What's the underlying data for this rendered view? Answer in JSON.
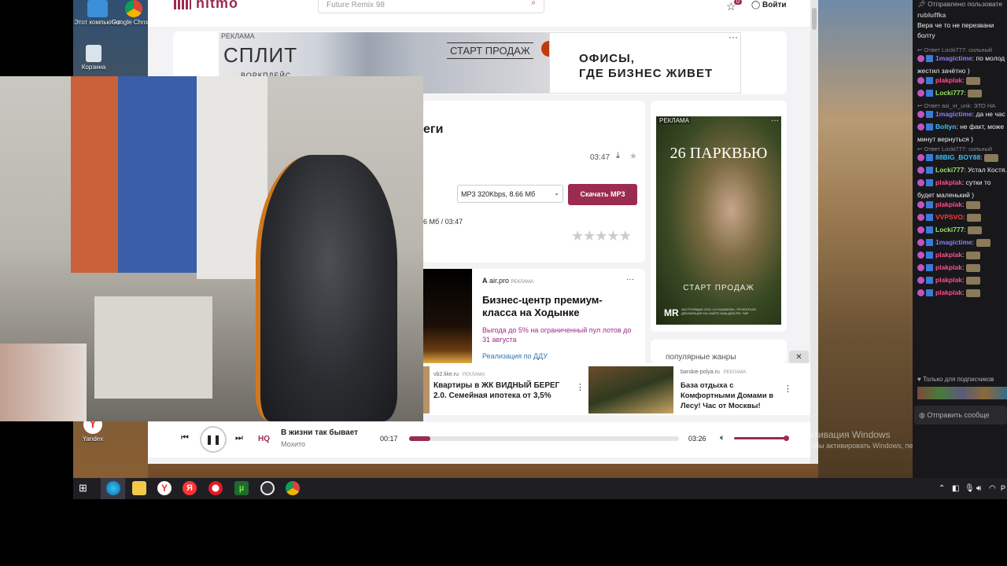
{
  "desktop": {
    "icons": [
      {
        "label": "Этот компьютер"
      },
      {
        "label": "Google Chrome"
      },
      {
        "label": "Корзина"
      },
      {
        "label": "Yandex"
      }
    ]
  },
  "site": {
    "logo": "hitmo",
    "search_value": "Future Remix 98",
    "star_count": "0",
    "login_label": "Войти"
  },
  "ad_top": {
    "tag": "РЕКЛАМА",
    "brand": "СПЛИТ",
    "brand_sub": "ВОРКПЛЕЙС",
    "start_label": "СТАРТ ПРОДАЖ",
    "headline_1": "ОФИСЫ,",
    "headline_2": "ГДЕ БИЗНЕС ЖИВЕТ",
    "more": "···"
  },
  "track_card": {
    "title_fragment": "еги",
    "duration": "03:47",
    "format_option": "MP3 320Kbps, 8.66 Мб",
    "download_label": "Скачать MP3",
    "size_info": "6 Мб / 03:47",
    "rating_stars": 5
  },
  "ad_bc": {
    "source": "air.pro",
    "tag": "РЕКЛАМА",
    "title": "Бизнес-центр премиум-класса на Ходынке",
    "offer": "Выгода до 5% на ограниченный пул лотов до 31 августа",
    "link": "Реализация по ДДУ",
    "more": "···"
  },
  "ad_side": {
    "tag": "РЕКЛАМА",
    "headline": "26 ПАРКВЬЮ",
    "start_label": "СТАРТ ПРОДАЖ",
    "brand": "MR",
    "fineprint": "ЗАСТРОЙЩИК ООО «СЗ КАЗАКОВ», ПРОЕКТНАЯ ДЕКЛАРАЦИЯ НА САЙТЕ НАШ.ДОМ.РФ. *MR"
  },
  "genres": {
    "label": "популярные жанры",
    "close": "✕"
  },
  "ad_bottom": {
    "left": {
      "source": "vb2.like.ru",
      "tag": "РЕКЛАМА",
      "title": "Квартиры в ЖК ВИДНЫЙ БЕРЕГ 2.0. Семейная ипотека от 3,5%",
      "more": "⋮"
    },
    "right": {
      "source": "barskie-polya.ru",
      "tag": "РЕКЛАМА",
      "title": "База отдыха с Комфортными Домами в Лесу! Час от Москвы!",
      "more": "⋮"
    }
  },
  "player": {
    "quality": "HQ",
    "song": "В жизни так бывает",
    "artist": "Мохито",
    "elapsed": "00:17",
    "total": "03:26",
    "progress_fraction": 0.08,
    "volume_fraction": 1.0
  },
  "watermark": {
    "line1": "Активация Windows",
    "line2": "Чтобы активировать Windows, перейдите в раздел \"Пар"
  },
  "chat": {
    "header": "Отправлено пользовате",
    "pinned_user": "rubluffka",
    "pinned_text": "Вера че то не перезвани",
    "pinned_text2": "болту",
    "lines": [
      {
        "kind": "reply",
        "text": "Ответ Locki777: сильный"
      },
      {
        "kind": "msg",
        "user": "1magictime",
        "color": "#8a7dff",
        "text": "по молод"
      },
      {
        "kind": "cont",
        "text": "жестил зачётно )"
      },
      {
        "kind": "msg",
        "user": "plakplak",
        "color": "#ff4f8a",
        "text": ""
      },
      {
        "kind": "msg",
        "user": "Locki777",
        "color": "#9be564",
        "text": ""
      },
      {
        "kind": "reply",
        "text": "Ответ asi_vr_unk: ЭТО НА"
      },
      {
        "kind": "msg",
        "user": "1magictime",
        "color": "#8a7dff",
        "text": "да не час"
      },
      {
        "kind": "msg",
        "user": "Boltyn",
        "color": "#3fbfff",
        "text": "не факт, може"
      },
      {
        "kind": "cont",
        "text": "минут вернуться )"
      },
      {
        "kind": "reply",
        "text": "Ответ Locki777: сильный"
      },
      {
        "kind": "msg",
        "user": "88BIG_BOY88",
        "color": "#3fbfff",
        "text": ""
      },
      {
        "kind": "msg",
        "user": "Locki777",
        "color": "#9be564",
        "text": "Устал Костя. В"
      },
      {
        "kind": "msg",
        "user": "plakplak",
        "color": "#ff4f8a",
        "text": "сутки то"
      },
      {
        "kind": "cont",
        "text": "будет маленький )"
      },
      {
        "kind": "msg",
        "user": "plakplak",
        "color": "#ff4f8a",
        "text": ""
      },
      {
        "kind": "msg",
        "user": "VVPSVO",
        "color": "#ff3b3b",
        "text": ""
      },
      {
        "kind": "msg",
        "user": "Locki777",
        "color": "#9be564",
        "text": ""
      },
      {
        "kind": "msg",
        "user": "1magictime",
        "color": "#8a7dff",
        "text": ""
      },
      {
        "kind": "msg",
        "user": "plakplak",
        "color": "#ff4f8a",
        "text": ""
      },
      {
        "kind": "msg",
        "user": "plakplak",
        "color": "#ff4f8a",
        "text": ""
      },
      {
        "kind": "msg",
        "user": "plakplak",
        "color": "#ff4f8a",
        "text": ""
      },
      {
        "kind": "msg",
        "user": "plakplak",
        "color": "#ff4f8a",
        "text": ""
      }
    ],
    "subs_only": "Только для подписчиков",
    "input_placeholder": "Отправить сообще"
  },
  "taskbar": {
    "icons": [
      "windows-start",
      "edge",
      "file-explorer",
      "yandex-browser",
      "yandex",
      "opera",
      "utorrent",
      "obs",
      "chrome"
    ],
    "tray_lang": "Р"
  }
}
